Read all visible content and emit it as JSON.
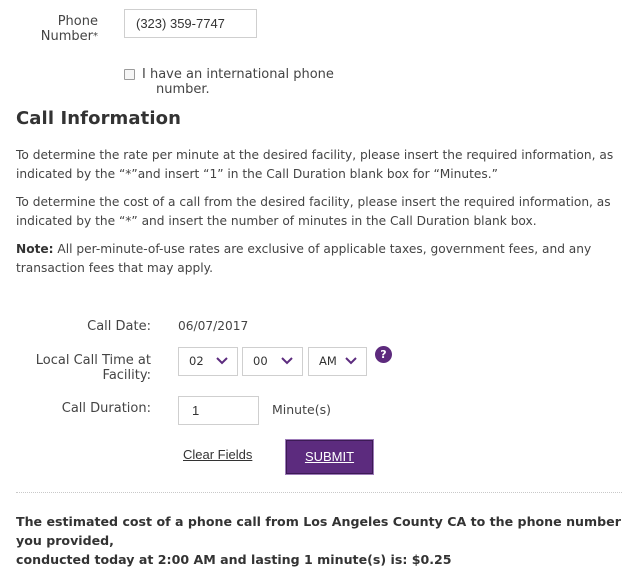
{
  "phone": {
    "label_line1": "Phone",
    "label_line2": "Number",
    "required_marker": "*",
    "value": "(323) 359-7747",
    "international_checkbox_label_line1": "I have an international phone",
    "international_checkbox_label_line2": "number.",
    "international_checked": false
  },
  "call_info": {
    "title": "Call Information",
    "para1_line1": "To determine the rate per minute at the desired facility, please insert the required information, as",
    "para1_line2": "indicated by the “*”and insert “1” in the Call Duration blank box for “Minutes.”",
    "para2_line1": "To determine the cost of a call from the desired facility, please insert the required information, as",
    "para2_line2": "indicated by the “*” and insert the number of minutes in the Call Duration blank box.",
    "note_label": "Note:",
    "note_line1": " All per-minute-of-use rates are exclusive of applicable taxes, government fees, and any",
    "note_line2": "transaction fees that may apply."
  },
  "form": {
    "call_date_label": "Call Date:",
    "call_date_value": "06/07/2017",
    "local_time_label_line1": "Local Call Time at",
    "local_time_label_line2": "Facility:",
    "hour_value": "02",
    "minute_value": "00",
    "ampm_value": "AM",
    "help_icon_glyph": "?",
    "duration_label": "Call Duration:",
    "duration_value": "1",
    "duration_unit": "Minute(s)",
    "clear_label": "Clear Fields",
    "submit_label": "SUBMIT"
  },
  "result": {
    "line1": "The estimated cost of a phone call from Los Angeles County CA to the phone number you provided,",
    "line2": "conducted today at 2:00 AM and lasting 1 minute(s) is: $0.25"
  },
  "colors": {
    "accent_purple": "#5c2b7e",
    "text": "#444444",
    "border": "#cfcfcf"
  },
  "icons": {
    "select_chevron": "chevron-down-icon",
    "help": "question-circle-icon"
  }
}
